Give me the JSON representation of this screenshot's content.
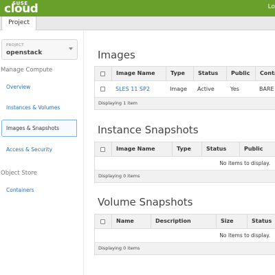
{
  "header": {
    "brand_top": "SUSE",
    "brand_main": "cloud",
    "top_right_text": "Lo",
    "colors": {
      "bar": "#69a02c",
      "link": "#2b6fb6"
    }
  },
  "tabs": [
    {
      "label": "Project",
      "active": true
    }
  ],
  "sidebar": {
    "project_label": "PROJECT",
    "project_name": "openstack",
    "manage_compute_heading": "Manage Compute",
    "items": [
      {
        "label": "Overview"
      },
      {
        "label": "Instances & Volumes"
      },
      {
        "label": "Images & Snapshots",
        "active": true
      },
      {
        "label": "Access & Security"
      }
    ],
    "object_store_heading": "Object Store",
    "object_store_items": [
      {
        "label": "Containers"
      }
    ]
  },
  "main": {
    "images": {
      "title": "Images",
      "columns": [
        "Image Name",
        "Type",
        "Status",
        "Public",
        "Conta"
      ],
      "rows": [
        {
          "name": "SLES 11 SP2",
          "type": "Image",
          "status": "Active",
          "public": "Yes",
          "container": "BARE"
        }
      ],
      "footer": "Displaying 1 item"
    },
    "instance_snapshots": {
      "title": "Instance Snapshots",
      "columns": [
        "Image Name",
        "Type",
        "Status",
        "Public"
      ],
      "empty_text": "No items to display.",
      "footer": "Displaying 0 items"
    },
    "volume_snapshots": {
      "title": "Volume Snapshots",
      "columns": [
        "Name",
        "Description",
        "Size",
        "Status"
      ],
      "empty_text": "No items to display.",
      "footer": "Displaying 0 items"
    }
  }
}
